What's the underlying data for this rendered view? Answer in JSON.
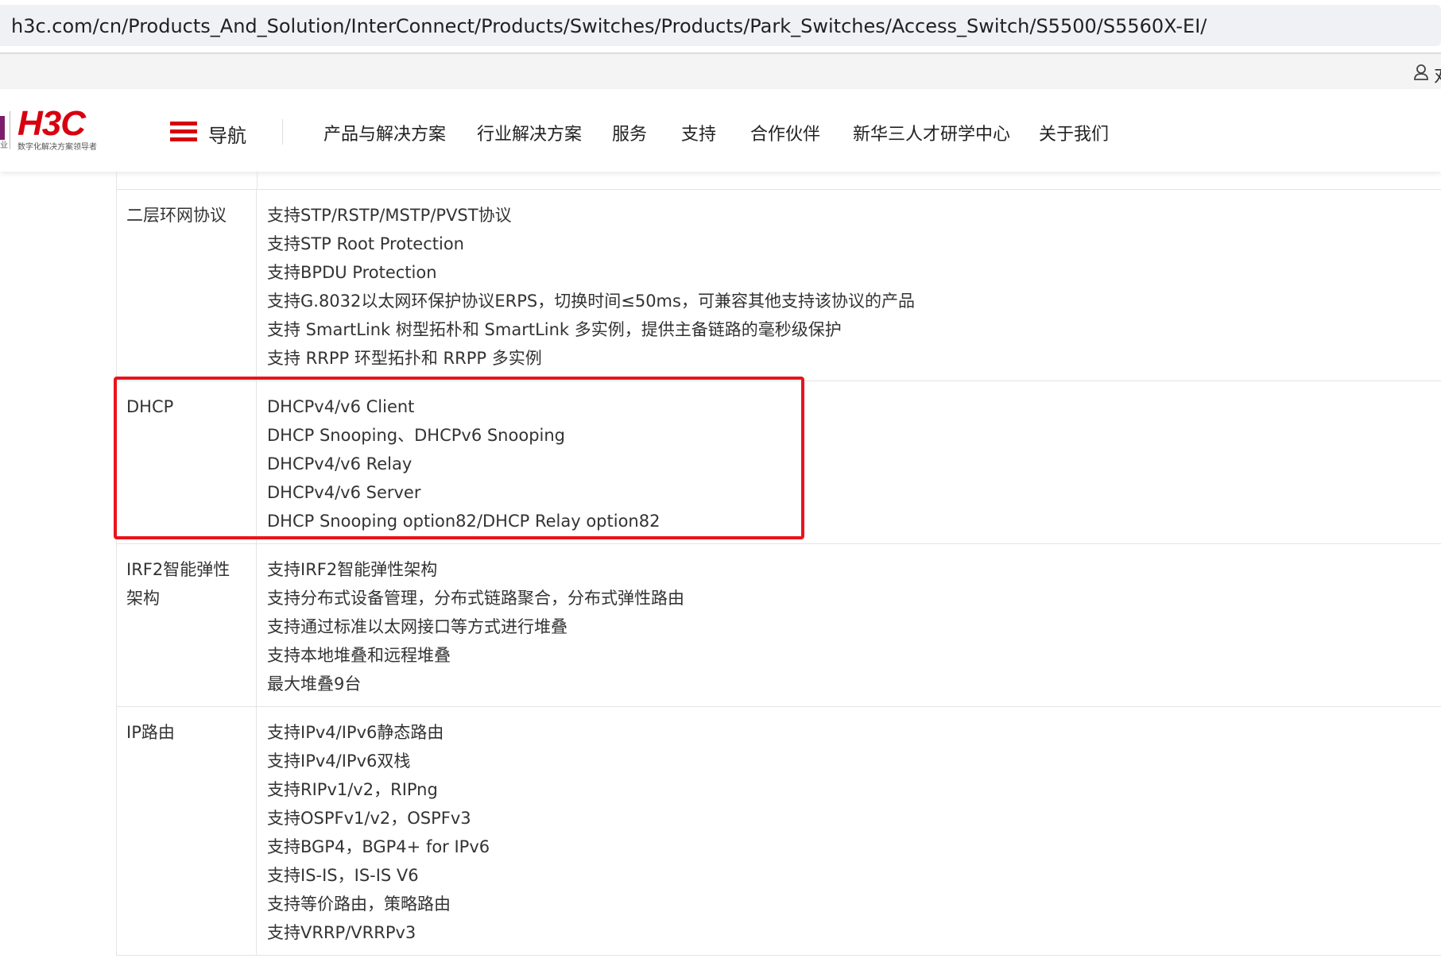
{
  "browser": {
    "url": "h3c.com/cn/Products_And_Solution/InterConnect/Products/Switches/Products/Park_Switches/Access_Switch/S5500/S5560X-EI/"
  },
  "utility": {
    "cutoff_text": "对"
  },
  "header": {
    "logo_text": "H3C",
    "logo_tagline": "数字化解决方案领导者",
    "logo_side_char": "业",
    "nav_label": "导航",
    "nav_items": [
      "产品与解决方案",
      "行业解决方案",
      "服务",
      "支持",
      "合作伙伴",
      "新华三人才研学中心",
      "关于我们"
    ]
  },
  "spec_rows": [
    {
      "label": "二层环网协议",
      "values": [
        "支持STP/RSTP/MSTP/PVST协议",
        "支持STP Root Protection",
        "支持BPDU Protection",
        "支持G.8032以太网环保护协议ERPS，切换时间≤50ms，可兼容其他支持该协议的产品",
        "支持 SmartLink 树型拓朴和 SmartLink 多实例，提供主备链路的毫秒级保护",
        "支持 RRPP 环型拓扑和 RRPP 多实例"
      ]
    },
    {
      "label": "DHCP",
      "values": [
        "DHCPv4/v6 Client",
        "DHCP Snooping、DHCPv6 Snooping",
        "DHCPv4/v6 Relay",
        "DHCPv4/v6 Server",
        "DHCP Snooping option82/DHCP Relay option82"
      ]
    },
    {
      "label": "IRF2智能弹性架构",
      "values": [
        "支持IRF2智能弹性架构",
        "支持分布式设备管理，分布式链路聚合，分布式弹性路由",
        "支持通过标准以太网接口等方式进行堆叠",
        "支持本地堆叠和远程堆叠",
        "最大堆叠9台"
      ]
    },
    {
      "label": "IP路由",
      "values": [
        "支持IPv4/IPv6静态路由",
        "支持IPv4/IPv6双栈",
        "支持RIPv1/v2，RIPng",
        "支持OSPFv1/v2，OSPFv3",
        "支持BGP4，BGP4+ for IPv6",
        "支持IS-IS，IS-IS V6",
        "支持等价路由，策略路由",
        "支持VRRP/VRRPv3"
      ]
    }
  ],
  "colors": {
    "brand_red": "#d7000f",
    "highlight_red": "#e8141b"
  }
}
